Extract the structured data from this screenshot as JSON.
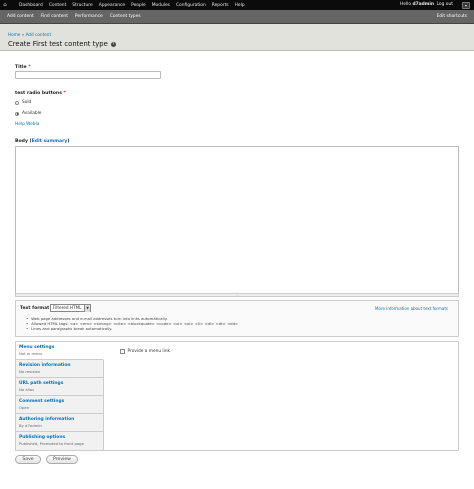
{
  "toolbar": {
    "menu": [
      "Dashboard",
      "Content",
      "Structure",
      "Appearance",
      "People",
      "Modules",
      "Configuration",
      "Reports",
      "Help"
    ],
    "user_greeting": "Hello ",
    "user_name": "d7admin",
    "logout": "Log out",
    "shortcuts": [
      "Add content",
      "Find content",
      "Performance",
      "Content types"
    ],
    "edit_shortcuts": "Edit shortcuts"
  },
  "header": {
    "breadcrumb": [
      "Home",
      "Add content"
    ],
    "title": "Create First test content type"
  },
  "form": {
    "title_label": "Title",
    "title_value": "",
    "radios_label": "test radio buttons",
    "radios": [
      {
        "label": "Sold",
        "checked": false
      },
      {
        "label": "Available",
        "checked": true
      }
    ],
    "help_text": "Help Webla",
    "body_label": "Body",
    "body_edit_summary": "Edit summary",
    "text_format_label": "Text format",
    "text_format_value": "Filtered HTML",
    "more_info": "More information about text formats",
    "format_tips": [
      "Web page addresses and e-mail addresses turn into links automatically.",
      "Allowed HTML tags: <a> <em> <strong> <cite> <blockquote> <code> <ul> <ol> <li> <dl> <dt> <dd>",
      "Lines and paragraphs break automatically."
    ]
  },
  "vertical_tabs": [
    {
      "title": "Menu settings",
      "summary": "Not in menu"
    },
    {
      "title": "Revision information",
      "summary": "No revision"
    },
    {
      "title": "URL path settings",
      "summary": "No alias"
    },
    {
      "title": "Comment settings",
      "summary": "Open"
    },
    {
      "title": "Authoring information",
      "summary": "By d7admin"
    },
    {
      "title": "Publishing options",
      "summary": "Published, Promoted to front page"
    }
  ],
  "menu_pane": {
    "checkbox_label": "Provide a menu link"
  },
  "actions": {
    "save": "Save",
    "preview": "Preview"
  }
}
